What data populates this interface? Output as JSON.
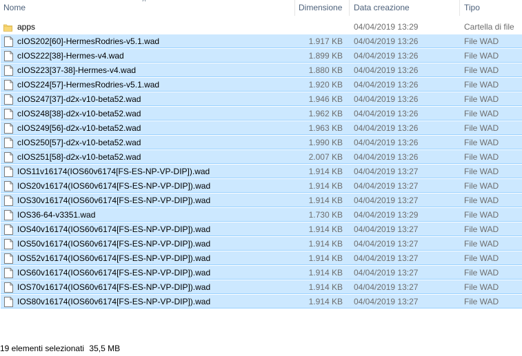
{
  "columns": {
    "name": "Nome",
    "size": "Dimensione",
    "date": "Data creazione",
    "type": "Tipo"
  },
  "files": [
    {
      "icon": "folder-icon",
      "name": "apps",
      "size": "",
      "date": "04/04/2019 13:29",
      "type": "Cartella di file",
      "selected": false
    },
    {
      "icon": "file-icon",
      "name": "cIOS202[60]-HermesRodries-v5.1.wad",
      "size": "1.917 KB",
      "date": "04/04/2019 13:26",
      "type": "File WAD",
      "selected": true
    },
    {
      "icon": "file-icon",
      "name": "cIOS222[38]-Hermes-v4.wad",
      "size": "1.899 KB",
      "date": "04/04/2019 13:26",
      "type": "File WAD",
      "selected": true
    },
    {
      "icon": "file-icon",
      "name": "cIOS223[37-38]-Hermes-v4.wad",
      "size": "1.880 KB",
      "date": "04/04/2019 13:26",
      "type": "File WAD",
      "selected": true
    },
    {
      "icon": "file-icon",
      "name": "cIOS224[57]-HermesRodries-v5.1.wad",
      "size": "1.920 KB",
      "date": "04/04/2019 13:26",
      "type": "File WAD",
      "selected": true
    },
    {
      "icon": "file-icon",
      "name": "cIOS247[37]-d2x-v10-beta52.wad",
      "size": "1.946 KB",
      "date": "04/04/2019 13:26",
      "type": "File WAD",
      "selected": true
    },
    {
      "icon": "file-icon",
      "name": "cIOS248[38]-d2x-v10-beta52.wad",
      "size": "1.962 KB",
      "date": "04/04/2019 13:26",
      "type": "File WAD",
      "selected": true
    },
    {
      "icon": "file-icon",
      "name": "cIOS249[56]-d2x-v10-beta52.wad",
      "size": "1.963 KB",
      "date": "04/04/2019 13:26",
      "type": "File WAD",
      "selected": true
    },
    {
      "icon": "file-icon",
      "name": "cIOS250[57]-d2x-v10-beta52.wad",
      "size": "1.990 KB",
      "date": "04/04/2019 13:26",
      "type": "File WAD",
      "selected": true
    },
    {
      "icon": "file-icon",
      "name": "cIOS251[58]-d2x-v10-beta52.wad",
      "size": "2.007 KB",
      "date": "04/04/2019 13:26",
      "type": "File WAD",
      "selected": true
    },
    {
      "icon": "file-icon",
      "name": "IOS11v16174(IOS60v6174[FS-ES-NP-VP-DIP]).wad",
      "size": "1.914 KB",
      "date": "04/04/2019 13:27",
      "type": "File WAD",
      "selected": true
    },
    {
      "icon": "file-icon",
      "name": "IOS20v16174(IOS60v6174[FS-ES-NP-VP-DIP]).wad",
      "size": "1.914 KB",
      "date": "04/04/2019 13:27",
      "type": "File WAD",
      "selected": true
    },
    {
      "icon": "file-icon",
      "name": "IOS30v16174(IOS60v6174[FS-ES-NP-VP-DIP]).wad",
      "size": "1.914 KB",
      "date": "04/04/2019 13:27",
      "type": "File WAD",
      "selected": true
    },
    {
      "icon": "file-icon",
      "name": "IOS36-64-v3351.wad",
      "size": "1.730 KB",
      "date": "04/04/2019 13:29",
      "type": "File WAD",
      "selected": true
    },
    {
      "icon": "file-icon",
      "name": "IOS40v16174(IOS60v6174[FS-ES-NP-VP-DIP]).wad",
      "size": "1.914 KB",
      "date": "04/04/2019 13:27",
      "type": "File WAD",
      "selected": true
    },
    {
      "icon": "file-icon",
      "name": "IOS50v16174(IOS60v6174[FS-ES-NP-VP-DIP]).wad",
      "size": "1.914 KB",
      "date": "04/04/2019 13:27",
      "type": "File WAD",
      "selected": true
    },
    {
      "icon": "file-icon",
      "name": "IOS52v16174(IOS60v6174[FS-ES-NP-VP-DIP]).wad",
      "size": "1.914 KB",
      "date": "04/04/2019 13:27",
      "type": "File WAD",
      "selected": true
    },
    {
      "icon": "file-icon",
      "name": "IOS60v16174(IOS60v6174[FS-ES-NP-VP-DIP]).wad",
      "size": "1.914 KB",
      "date": "04/04/2019 13:27",
      "type": "File WAD",
      "selected": true
    },
    {
      "icon": "file-icon",
      "name": "IOS70v16174(IOS60v6174[FS-ES-NP-VP-DIP]).wad",
      "size": "1.914 KB",
      "date": "04/04/2019 13:27",
      "type": "File WAD",
      "selected": true
    },
    {
      "icon": "file-icon",
      "name": "IOS80v16174(IOS60v6174[FS-ES-NP-VP-DIP]).wad",
      "size": "1.914 KB",
      "date": "04/04/2019 13:27",
      "type": "File WAD",
      "selected": true
    }
  ],
  "status_bar": {
    "selected_count": "19 elementi selezionati",
    "selected_size": "35,5 MB"
  },
  "colors": {
    "selection_fill": "#cce8ff",
    "selection_border": "#99d1ff",
    "folder": "#f8d775",
    "header_text": "#4c607a"
  },
  "sort_indicator": "chevron-up-icon"
}
